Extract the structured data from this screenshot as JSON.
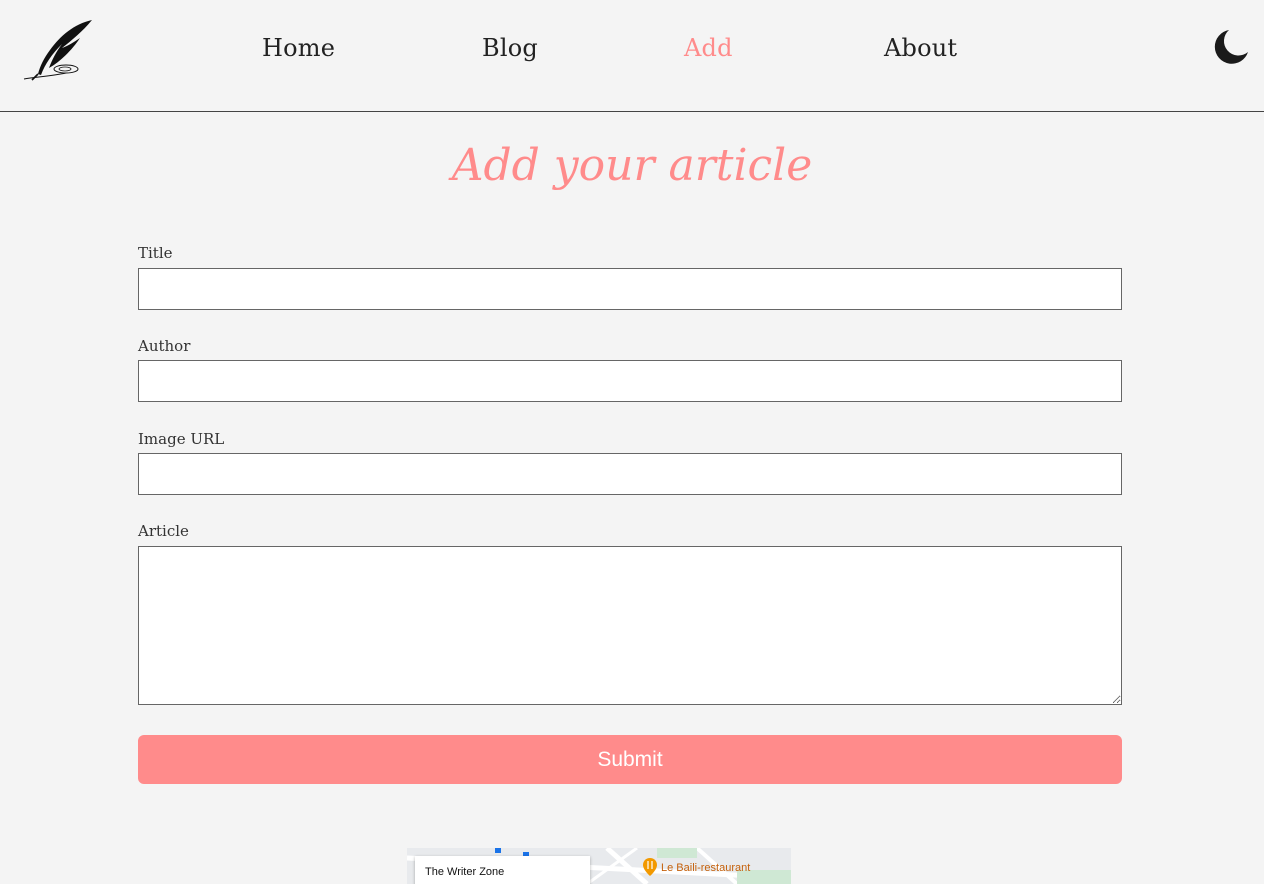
{
  "header": {
    "logo_icon": "quill-pen-icon",
    "nav": [
      {
        "label": "Home"
      },
      {
        "label": "Blog"
      },
      {
        "label": "Add"
      },
      {
        "label": "About"
      }
    ],
    "active_nav": "Add",
    "theme_toggle_icon": "moon-icon"
  },
  "main": {
    "title": "Add your article",
    "fields": {
      "title_label": "Title",
      "title_value": "",
      "author_label": "Author",
      "author_value": "",
      "image_url_label": "Image URL",
      "image_url_value": "",
      "article_label": "Article",
      "article_value": ""
    },
    "submit_label": "Submit"
  },
  "map": {
    "place_title": "The Writer Zone",
    "poi_label": "Le Baili-restaurant",
    "poi_icon": "restaurant-pin-icon"
  },
  "colors": {
    "accent": "#ff8b8b",
    "background": "#f4f4f4",
    "text": "#222222"
  }
}
